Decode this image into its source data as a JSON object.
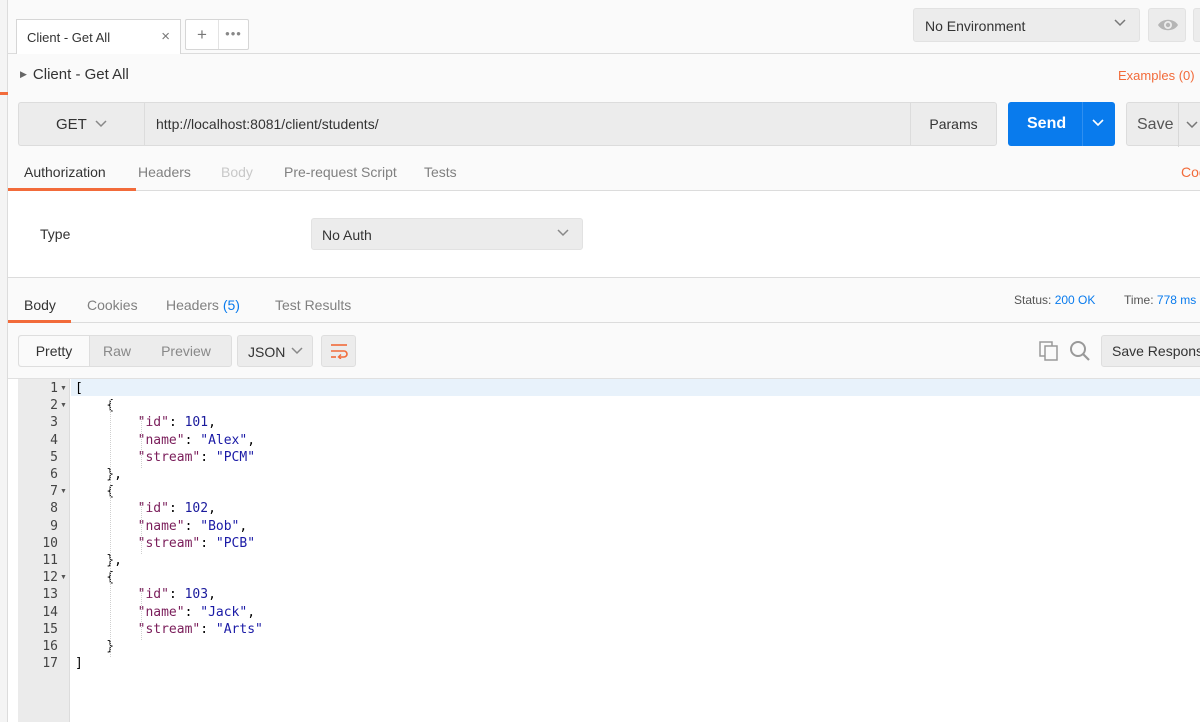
{
  "tabs": {
    "active_tab_label": "Client - Get All",
    "close_glyph": "×",
    "new_tab_glyph": "+",
    "more_glyph": "•••"
  },
  "environment": {
    "selected": "No Environment"
  },
  "request": {
    "title": "Client - Get All",
    "examples_link": "Examples (0)",
    "method": "GET",
    "url": "http://localhost:8081/client/students/",
    "params_label": "Params",
    "send_label": "Send",
    "save_label": "Save",
    "tabs": [
      {
        "label": "Authorization",
        "state": "active"
      },
      {
        "label": "Headers",
        "state": "normal"
      },
      {
        "label": "Body",
        "state": "disabled"
      },
      {
        "label": "Pre-request Script",
        "state": "normal"
      },
      {
        "label": "Tests",
        "state": "normal"
      }
    ],
    "code_link": "Cod"
  },
  "auth": {
    "type_label": "Type",
    "selected": "No Auth"
  },
  "response": {
    "tabs": {
      "body": "Body",
      "cookies": "Cookies",
      "headers": "Headers",
      "headers_count": "(5)",
      "test_results": "Test Results"
    },
    "status_label": "Status:",
    "status_value": "200 OK",
    "time_label": "Time:",
    "time_value": "778 ms",
    "view_modes": [
      "Pretty",
      "Raw",
      "Preview"
    ],
    "active_view": "Pretty",
    "format": "JSON",
    "save_response_label": "Save Response"
  },
  "code_lines": [
    {
      "n": "1",
      "fold": true,
      "text": "["
    },
    {
      "n": "2",
      "fold": true,
      "text": "    {"
    },
    {
      "n": "3",
      "fold": false,
      "key": "\"id\"",
      "sep": ": ",
      "val": "101",
      "vtype": "num",
      "tail": ",",
      "indent": "        "
    },
    {
      "n": "4",
      "fold": false,
      "key": "\"name\"",
      "sep": ": ",
      "val": "\"Alex\"",
      "vtype": "str",
      "tail": ",",
      "indent": "        "
    },
    {
      "n": "5",
      "fold": false,
      "key": "\"stream\"",
      "sep": ": ",
      "val": "\"PCM\"",
      "vtype": "str",
      "tail": "",
      "indent": "        "
    },
    {
      "n": "6",
      "fold": false,
      "text": "    },"
    },
    {
      "n": "7",
      "fold": true,
      "text": "    {"
    },
    {
      "n": "8",
      "fold": false,
      "key": "\"id\"",
      "sep": ": ",
      "val": "102",
      "vtype": "num",
      "tail": ",",
      "indent": "        "
    },
    {
      "n": "9",
      "fold": false,
      "key": "\"name\"",
      "sep": ": ",
      "val": "\"Bob\"",
      "vtype": "str",
      "tail": ",",
      "indent": "        "
    },
    {
      "n": "10",
      "fold": false,
      "key": "\"stream\"",
      "sep": ": ",
      "val": "\"PCB\"",
      "vtype": "str",
      "tail": "",
      "indent": "        "
    },
    {
      "n": "11",
      "fold": false,
      "text": "    },"
    },
    {
      "n": "12",
      "fold": true,
      "text": "    {"
    },
    {
      "n": "13",
      "fold": false,
      "key": "\"id\"",
      "sep": ": ",
      "val": "103",
      "vtype": "num",
      "tail": ",",
      "indent": "        "
    },
    {
      "n": "14",
      "fold": false,
      "key": "\"name\"",
      "sep": ": ",
      "val": "\"Jack\"",
      "vtype": "str",
      "tail": ",",
      "indent": "        "
    },
    {
      "n": "15",
      "fold": false,
      "key": "\"stream\"",
      "sep": ": ",
      "val": "\"Arts\"",
      "vtype": "str",
      "tail": "",
      "indent": "        "
    },
    {
      "n": "16",
      "fold": false,
      "text": "    }"
    },
    {
      "n": "17",
      "fold": false,
      "text": "]"
    }
  ],
  "colors": {
    "accent": "#f26b3a",
    "send_blue": "#097bed",
    "json_key": "#7a1d5a",
    "json_string": "#1a1aa6"
  }
}
